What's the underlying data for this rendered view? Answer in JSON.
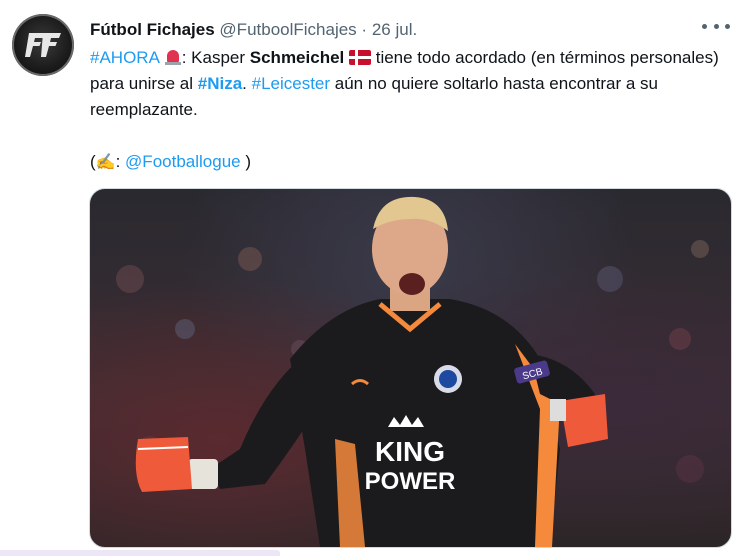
{
  "tweet": {
    "author_name": "Fútbol Fichajes",
    "handle": "@FutboolFichajes",
    "separator": "·",
    "date": "26 jul.",
    "text": {
      "hashtag_ahora": "#AHORA",
      "colon_kasper": ": Kasper ",
      "schmeichel": "Schmeichel",
      "line1_rest": " tiene todo acordado (en términos personales) para unirse al ",
      "hashtag_niza": "#Niza",
      "dot": ". ",
      "hashtag_leicester": "#Leicester",
      "line2_rest": " aún no quiere soltarlo hasta encontrar a su reemplazante.",
      "credit_open": "(",
      "credit_pen": "✍",
      "credit_colon": ": ",
      "credit_mention": "@Footballogue",
      "credit_close": " )"
    },
    "media": {
      "sponsor": "KING POWER",
      "sleeve": "SCB"
    }
  },
  "icons": {
    "more": "more-horizontal-icon",
    "siren": "rotating-light-icon",
    "flag": "denmark-flag-icon",
    "pen": "writing-hand-icon"
  },
  "colors": {
    "link": "#1d9bf0",
    "text": "#0f1419",
    "secondary": "#536471",
    "jersey": "#1a1a1a",
    "jersey_trim": "#f58a3c"
  }
}
